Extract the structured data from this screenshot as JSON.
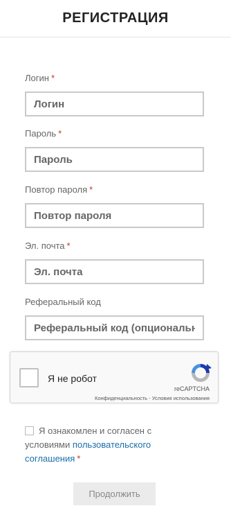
{
  "header": {
    "title": "РЕГИСТРАЦИЯ"
  },
  "form": {
    "login": {
      "label": "Логин",
      "required": "*",
      "placeholder": "Логин"
    },
    "password": {
      "label": "Пароль",
      "required": "*",
      "placeholder": "Пароль"
    },
    "password_repeat": {
      "label": "Повтор пароля",
      "required": "*",
      "placeholder": "Повтор пароля"
    },
    "email": {
      "label": "Эл. почта",
      "required": "*",
      "placeholder": "Эл. почта"
    },
    "referral": {
      "label": "Реферальный код",
      "placeholder": "Реферальный код (опциональн"
    }
  },
  "recaptcha": {
    "label": "Я не робот",
    "brand": "reCAPTCHA",
    "links": "Конфиденциальность - Условия использования",
    "colors": {
      "blue": "#1c3aa9",
      "light_blue": "#4a90e2",
      "gray": "#b8b8b8"
    }
  },
  "agreement": {
    "text": "Я ознакомлен и согласен с условиями",
    "link_text": "пользовательского соглашения",
    "required": "*"
  },
  "submit": {
    "label": "Продолжить"
  },
  "colors": {
    "required": "#c0392b",
    "link": "#1a6fa8"
  }
}
